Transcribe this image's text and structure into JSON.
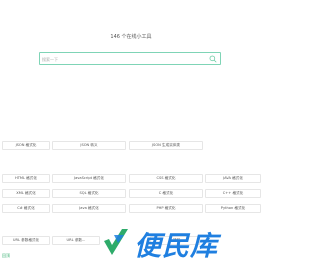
{
  "header": {
    "title": "146 个在线小工具"
  },
  "search": {
    "placeholder": "搜索一下"
  },
  "tools": {
    "row1": [
      "JSON 格式化",
      "JSON 转义",
      "JSON 生成实体类"
    ],
    "row2": [
      "HTML 格式化",
      "JavaScript 格式化",
      "CSS 格式化",
      "JAVA 格式化"
    ],
    "row3": [
      "XML 格式化",
      "SQL 格式化",
      "C 格式化",
      "C++ 格式化"
    ],
    "row4": [
      "C# 格式化",
      "Java 格式化",
      "PHP 格式化",
      "Python 格式化"
    ],
    "row5": [
      "URL 参数格式化",
      "URL 参数...",
      "...转码"
    ]
  },
  "footer": {
    "link": "回顶"
  },
  "watermark": {
    "text": "便民库"
  },
  "colors": {
    "accent": "#2eab6a",
    "search_border": "#7fd4b6",
    "watermark_blue": "#1f7fe0"
  }
}
